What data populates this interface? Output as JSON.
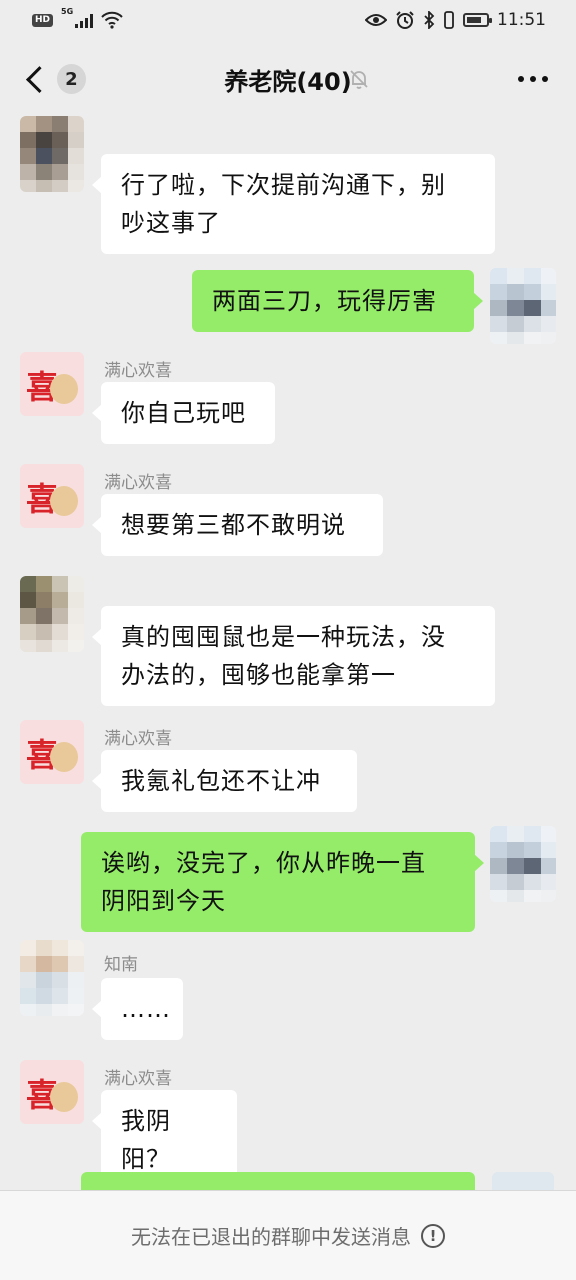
{
  "status_bar": {
    "hd": "HD",
    "network": "5G",
    "time": "11:51",
    "battery_level_pct": 80
  },
  "header": {
    "unread_count": "2",
    "title": "养老院(40)"
  },
  "messages": [
    {
      "direction": "in",
      "sender": "",
      "text_lines": [
        "行了啦，下次提前沟通下，别",
        "吵这事了"
      ]
    },
    {
      "direction": "out",
      "text_lines": [
        "两面三刀，玩得厉害"
      ]
    },
    {
      "direction": "in",
      "sender": "满心欢喜",
      "text_lines": [
        "你自己玩吧"
      ]
    },
    {
      "direction": "in",
      "sender": "满心欢喜",
      "text_lines": [
        "想要第三都不敢明说"
      ]
    },
    {
      "direction": "in",
      "sender": "",
      "text_lines": [
        "真的囤囤鼠也是一种玩法，没",
        "办法的，囤够也能拿第一"
      ]
    },
    {
      "direction": "in",
      "sender": "满心欢喜",
      "text_lines": [
        "我氪礼包还不让冲"
      ]
    },
    {
      "direction": "out",
      "text_lines": [
        "诶哟，没完了，你从昨晚一直",
        "阴阳到今天"
      ]
    },
    {
      "direction": "in",
      "sender": "知南",
      "text_lines": [
        "……"
      ]
    },
    {
      "direction": "in",
      "sender": "满心欢喜",
      "text_lines": [
        "我阴阳？"
      ]
    }
  ],
  "avatar_glyph": "喜",
  "footer": {
    "notice": "无法在已退出的群聊中发送消息",
    "info_glyph": "!"
  },
  "colors": {
    "background": "#ededed",
    "outgoing_bubble": "#95ec69",
    "incoming_bubble": "#ffffff"
  }
}
